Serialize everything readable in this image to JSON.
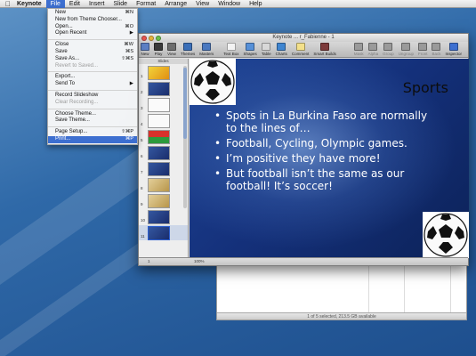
{
  "menubar": {
    "app_name": "Keynote",
    "items": [
      "File",
      "Edit",
      "Insert",
      "Slide",
      "Format",
      "Arrange",
      "View",
      "Window",
      "Help"
    ],
    "active_item": "File"
  },
  "file_menu": {
    "groups": [
      [
        {
          "label": "New",
          "shortcut": "⌘N",
          "disabled": false
        },
        {
          "label": "New from Theme Chooser...",
          "shortcut": "",
          "disabled": false
        },
        {
          "label": "Open...",
          "shortcut": "⌘O",
          "disabled": false
        },
        {
          "label": "Open Recent",
          "shortcut": "▶",
          "disabled": false
        }
      ],
      [
        {
          "label": "Close",
          "shortcut": "⌘W",
          "disabled": false
        },
        {
          "label": "Save",
          "shortcut": "⌘S",
          "disabled": false
        },
        {
          "label": "Save As...",
          "shortcut": "⇧⌘S",
          "disabled": false
        },
        {
          "label": "Revert to Saved...",
          "shortcut": "",
          "disabled": true
        }
      ],
      [
        {
          "label": "Export...",
          "shortcut": "",
          "disabled": false
        },
        {
          "label": "Send To",
          "shortcut": "▶",
          "disabled": false
        }
      ],
      [
        {
          "label": "Record Slideshow",
          "shortcut": "",
          "disabled": false
        },
        {
          "label": "Clear Recording...",
          "shortcut": "",
          "disabled": true
        }
      ],
      [
        {
          "label": "Choose Theme...",
          "shortcut": "",
          "disabled": false
        },
        {
          "label": "Save Theme...",
          "shortcut": "",
          "disabled": false
        }
      ],
      [
        {
          "label": "Page Setup...",
          "shortcut": "⇧⌘P",
          "disabled": false
        },
        {
          "label": "Print...",
          "shortcut": "⌘P",
          "disabled": false,
          "highlight": true
        }
      ]
    ]
  },
  "keynote": {
    "window_title": "Keynote ... r_Fabienne - 1",
    "toolbar": {
      "left": [
        {
          "label": "New",
          "icon": "new-slide-icon",
          "color": "#5a7fc4",
          "disabled": false
        },
        {
          "label": "Play",
          "icon": "play-icon",
          "color": "#3a3a3a",
          "disabled": false
        },
        {
          "label": "View",
          "icon": "view-icon",
          "color": "#6d6d6d",
          "disabled": false
        },
        {
          "label": "Themes",
          "icon": "themes-icon",
          "color": "#3b6fb8",
          "disabled": false
        },
        {
          "label": "Masters",
          "icon": "masters-icon",
          "color": "#4a78c0",
          "disabled": false
        }
      ],
      "middle": [
        {
          "label": "Text Box",
          "icon": "text-box-icon",
          "color": "#f3f3f3",
          "disabled": false
        },
        {
          "label": "Shapes",
          "icon": "shapes-icon",
          "color": "#5690d8",
          "disabled": false
        },
        {
          "label": "Table",
          "icon": "table-icon",
          "color": "#d8d8d8",
          "disabled": false
        },
        {
          "label": "Charts",
          "icon": "charts-icon",
          "color": "#3f85d0",
          "disabled": false
        },
        {
          "label": "Comment",
          "icon": "comment-icon",
          "color": "#f3e08a",
          "disabled": false
        },
        {
          "label": "Smart Builds",
          "icon": "smart-builds-icon",
          "color": "#7d3a3a",
          "disabled": false
        }
      ],
      "right": [
        {
          "label": "Mask",
          "icon": "mask-icon",
          "color": "#9a9a9a",
          "disabled": true
        },
        {
          "label": "Alpha",
          "icon": "alpha-icon",
          "color": "#9a9a9a",
          "disabled": true
        },
        {
          "label": "Group",
          "icon": "group-icon",
          "color": "#9a9a9a",
          "disabled": true
        },
        {
          "label": "Ungroup",
          "icon": "ungroup-icon",
          "color": "#9a9a9a",
          "disabled": true
        },
        {
          "label": "Front",
          "icon": "front-icon",
          "color": "#9a9a9a",
          "disabled": true
        },
        {
          "label": "Back",
          "icon": "back-icon",
          "color": "#9a9a9a",
          "disabled": true
        },
        {
          "label": "Inspector",
          "icon": "inspector-icon",
          "color": "#3d6fd0",
          "disabled": false
        }
      ]
    },
    "navigator": {
      "header": "Slides",
      "slides": [
        {
          "num": "1",
          "style": "yellow"
        },
        {
          "num": "2",
          "style": "blue"
        },
        {
          "num": "3",
          "style": "white"
        },
        {
          "num": "4",
          "style": "white"
        },
        {
          "num": "5",
          "style": "flag"
        },
        {
          "num": "6",
          "style": "blue"
        },
        {
          "num": "7",
          "style": "blue"
        },
        {
          "num": "8",
          "style": "sepia"
        },
        {
          "num": "9",
          "style": "sepia"
        },
        {
          "num": "10",
          "style": "blue"
        },
        {
          "num": "11",
          "style": "blue",
          "selected": true
        }
      ]
    },
    "slide": {
      "title": "Sports",
      "bullets": [
        "Spots in La Burkina Faso are normally to the lines of…",
        "Football, Cycling, Olympic games.",
        "I’m positive they have more!",
        "But football isn’t the same as our football! It’s soccer!"
      ]
    },
    "status": {
      "zoom": "100%",
      "slide_count": "1"
    }
  },
  "finder": {
    "status_text": "1 of 5 selected, 213.5 GB available"
  }
}
